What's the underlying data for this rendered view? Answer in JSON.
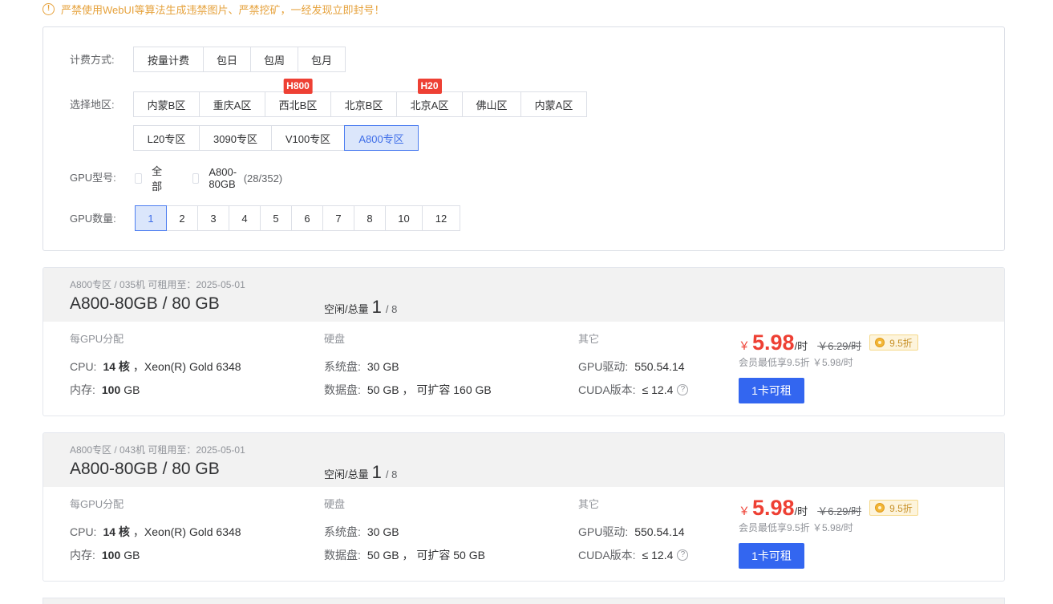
{
  "warning": {
    "icon": "exclamation-circle-icon",
    "text": "严禁使用WebUI等算法生成违禁图片、严禁挖矿，一经发现立即封号！"
  },
  "filters": {
    "billing": {
      "label": "计费方式:",
      "options": [
        "按量计费",
        "包日",
        "包周",
        "包月"
      ],
      "selected": "按量计费"
    },
    "region": {
      "label": "选择地区:",
      "row1": [
        {
          "label": "内蒙B区",
          "tag": ""
        },
        {
          "label": "重庆A区",
          "tag": ""
        },
        {
          "label": "西北B区",
          "tag": "H800"
        },
        {
          "label": "北京B区",
          "tag": ""
        },
        {
          "label": "北京A区",
          "tag": "H20"
        },
        {
          "label": "佛山区",
          "tag": ""
        },
        {
          "label": "内蒙A区",
          "tag": ""
        }
      ],
      "row2": [
        "L20专区",
        "3090专区",
        "V100专区",
        "A800专区"
      ],
      "selected": "A800专区"
    },
    "gpu_model": {
      "label": "GPU型号:",
      "all_label": "全部",
      "model_label": "A800-80GB",
      "model_count": "(28/352)"
    },
    "gpu_count": {
      "label": "GPU数量:",
      "options": [
        "1",
        "2",
        "3",
        "4",
        "5",
        "6",
        "7",
        "8",
        "10",
        "12"
      ],
      "selected": "1"
    }
  },
  "cards": [
    {
      "meta": "A800专区 / 035机   可租用至：2025-05-01",
      "title": "A800-80GB / 80 GB",
      "idle_label": "空闲/总量",
      "idle": "1",
      "total": "/ 8",
      "per_gpu_header": "每GPU分配",
      "cpu_key": "CPU:",
      "cpu_cores": "14 核",
      "cpu_model": "，Xeon(R) Gold 6348",
      "mem_key": "内存:",
      "mem_value": "100",
      "mem_unit": "GB",
      "disk_header": "硬盘",
      "sys_disk_key": "系统盘:",
      "sys_disk_value": "30 GB",
      "data_disk_key": "数据盘:",
      "data_disk_value": "50 GB ， 可扩容 160 GB",
      "other_header": "其它",
      "driver_key": "GPU驱动:",
      "driver_value": "550.54.14",
      "cuda_key": "CUDA版本:",
      "cuda_value": "≤ 12.4",
      "currency": "￥",
      "price": "5.98",
      "price_unit": "/时",
      "orig_price": "￥6.29/时",
      "discount": "9.5折",
      "member_note": "会员最低享9.5折 ￥5.98/时",
      "rent_button": "1卡可租"
    },
    {
      "meta": "A800专区 / 043机   可租用至：2025-05-01",
      "title": "A800-80GB / 80 GB",
      "idle_label": "空闲/总量",
      "idle": "1",
      "total": "/ 8",
      "per_gpu_header": "每GPU分配",
      "cpu_key": "CPU:",
      "cpu_cores": "14 核",
      "cpu_model": "，Xeon(R) Gold 6348",
      "mem_key": "内存:",
      "mem_value": "100",
      "mem_unit": "GB",
      "disk_header": "硬盘",
      "sys_disk_key": "系统盘:",
      "sys_disk_value": "30 GB",
      "data_disk_key": "数据盘:",
      "data_disk_value": "50 GB ， 可扩容 50 GB",
      "other_header": "其它",
      "driver_key": "GPU驱动:",
      "driver_value": "550.54.14",
      "cuda_key": "CUDA版本:",
      "cuda_value": "≤ 12.4",
      "currency": "￥",
      "price": "5.98",
      "price_unit": "/时",
      "orig_price": "￥6.29/时",
      "discount": "9.5折",
      "member_note": "会员最低享9.5折 ￥5.98/时",
      "rent_button": "1卡可租"
    }
  ]
}
